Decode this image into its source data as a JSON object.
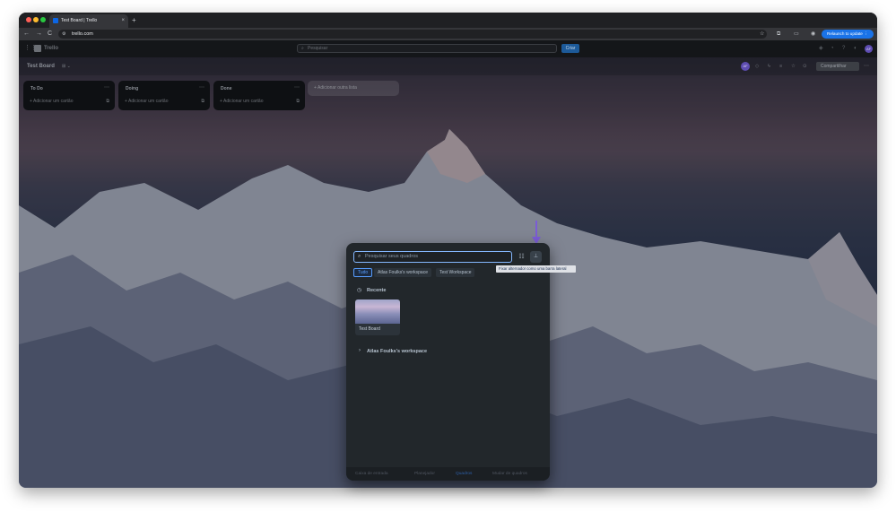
{
  "browser": {
    "tab_title": "Test Board | Trello",
    "tab_close": "×",
    "new_tab": "+",
    "url": "trello.com",
    "relaunch_label": "Relaunch to update ⋮",
    "nav": {
      "back": "←",
      "forward": "→",
      "reload": "C"
    }
  },
  "trello_nav": {
    "logo_text": "Trello",
    "search_placeholder": "Pesquisar",
    "create_label": "Criar",
    "avatar_initials": "AF"
  },
  "board": {
    "title": "Test Board",
    "view_label": "⊞ ⌄",
    "avatar_initials": "AF",
    "share_label": "Compartilhar",
    "lists": [
      {
        "title": "To Do",
        "add_card": "+ Adicionar um cartão"
      },
      {
        "title": "Doing",
        "add_card": "+ Adicionar um cartão"
      },
      {
        "title": "Done",
        "add_card": "+ Adicionar um cartão"
      }
    ],
    "add_list": "+ Adicionar outra lista"
  },
  "switcher": {
    "search_placeholder": "Pesquisar seus quadros",
    "filters": [
      "Tudo",
      "Atlas Foulks's workspace",
      "Test Workspace"
    ],
    "recent_label": "Recente",
    "recent_boards": [
      {
        "title": "Test Board"
      }
    ],
    "workspace_label": "Atlas Foulks's workspace",
    "pin_tooltip": "Fixar alternador como uma barra lateral",
    "bottom_nav": [
      "Caixa de entrada",
      "Planejador",
      "Quadros",
      "Mudar de quadros"
    ]
  },
  "colors": {
    "accent": "#579dff",
    "annotation_arrow": "#7b5cd6",
    "relaunch": "#1a73e8"
  }
}
